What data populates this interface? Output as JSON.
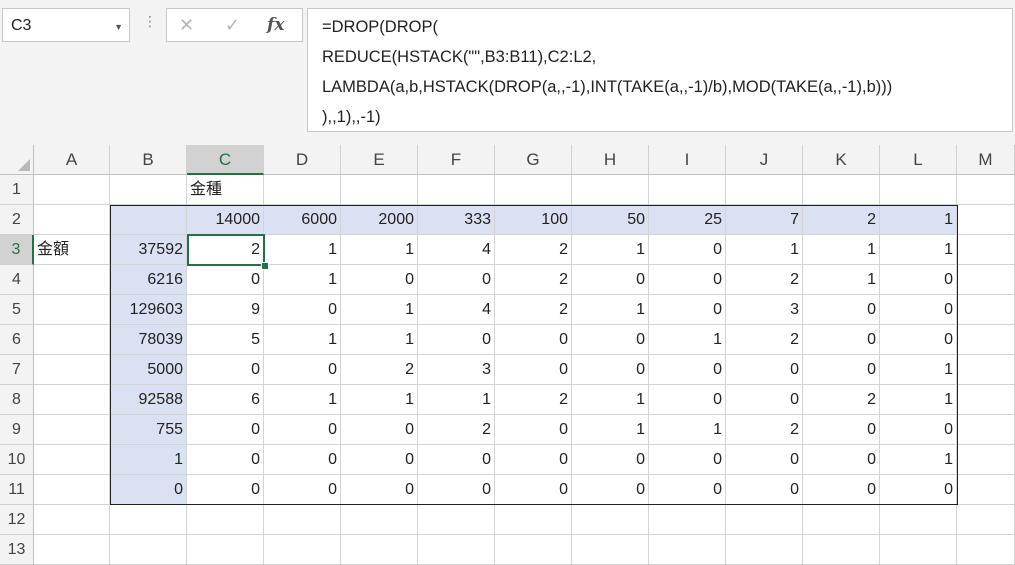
{
  "name_box": {
    "value": "C3"
  },
  "formula_bar": {
    "cancel_glyph": "✕",
    "enter_glyph": "✓",
    "fx_label": "fx",
    "lines": [
      "=DROP(DROP(",
      "REDUCE(HSTACK(\"\",B3:B11),C2:L2,",
      "LAMBDA(a,b,HSTACK(DROP(a,,-1),INT(TAKE(a,,-1)/b),MOD(TAKE(a,,-1),b)))",
      "),,1),,-1)"
    ]
  },
  "grid": {
    "columns": [
      "A",
      "B",
      "C",
      "D",
      "E",
      "F",
      "G",
      "H",
      "I",
      "J",
      "K",
      "L",
      "M"
    ],
    "rows": [
      "1",
      "2",
      "3",
      "4",
      "5",
      "6",
      "7",
      "8",
      "9",
      "10",
      "11",
      "12",
      "13"
    ],
    "selected_column": "C",
    "selected_row": "3",
    "label_kinshu": "金種",
    "label_kingaku": "金額",
    "denominations": [
      "14000",
      "6000",
      "2000",
      "333",
      "100",
      "50",
      "25",
      "7",
      "2",
      "1"
    ],
    "amounts": [
      "37592",
      "6216",
      "129603",
      "78039",
      "5000",
      "92588",
      "755",
      "1",
      "0"
    ],
    "results": [
      [
        "2",
        "1",
        "1",
        "4",
        "2",
        "1",
        "0",
        "1",
        "1",
        "1"
      ],
      [
        "0",
        "1",
        "0",
        "0",
        "2",
        "0",
        "0",
        "2",
        "1",
        "0"
      ],
      [
        "9",
        "0",
        "1",
        "4",
        "2",
        "1",
        "0",
        "3",
        "0",
        "0"
      ],
      [
        "5",
        "1",
        "1",
        "0",
        "0",
        "0",
        "1",
        "2",
        "0",
        "0"
      ],
      [
        "0",
        "0",
        "2",
        "3",
        "0",
        "0",
        "0",
        "0",
        "0",
        "1"
      ],
      [
        "6",
        "1",
        "1",
        "1",
        "2",
        "1",
        "0",
        "0",
        "2",
        "1"
      ],
      [
        "0",
        "0",
        "0",
        "2",
        "0",
        "1",
        "1",
        "2",
        "0",
        "0"
      ],
      [
        "0",
        "0",
        "0",
        "0",
        "0",
        "0",
        "0",
        "0",
        "0",
        "1"
      ],
      [
        "0",
        "0",
        "0",
        "0",
        "0",
        "0",
        "0",
        "0",
        "0",
        "0"
      ]
    ]
  }
}
